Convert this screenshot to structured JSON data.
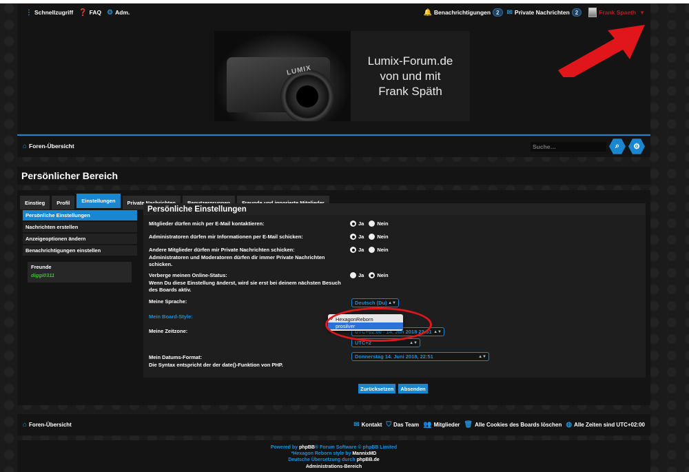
{
  "topnav": {
    "quicklinks": "Schnellzugriff",
    "faq": "FAQ",
    "admin": "Adm.",
    "notifications": "Benachrichtigungen",
    "notifications_count": "2",
    "messages": "Private Nachrichten",
    "messages_count": "2",
    "username": "Frank Spaeth"
  },
  "banner": {
    "line1": "Lumix-Forum.de",
    "line2": "von und mit",
    "line3": "Frank Späth",
    "camera_logo": "LUMIX"
  },
  "navbar": {
    "index_link": "Foren-Übersicht",
    "search_placeholder": "Suche…"
  },
  "page_title": "Persönlicher Bereich",
  "tabs": [
    {
      "label": "Einstieg"
    },
    {
      "label": "Profil"
    },
    {
      "label": "Einstellungen",
      "active": true
    },
    {
      "label": "Private Nachrichten"
    },
    {
      "label": "Benutzergruppen"
    },
    {
      "label": "Freunde und ignorierte Mitglieder"
    }
  ],
  "sidebar": {
    "items": [
      {
        "label": "Persönliche Einstellungen",
        "active": true
      },
      {
        "label": "Nachrichten erstellen"
      },
      {
        "label": "Anzeigeoptionen ändern"
      },
      {
        "label": "Benachrichtigungen einstellen"
      }
    ],
    "friends_heading": "Freunde",
    "friend_name": "diggi0311"
  },
  "settings": {
    "title": "Persönliche Einstellungen",
    "yes": "Ja",
    "no": "Nein",
    "email_contact": "Mitglieder dürfen mich per E-Mail kontaktieren:",
    "admin_email": "Administratoren dürfen mir Informationen per E-Mail schicken:",
    "pm_line1": "Andere Mitglieder dürfen mir Private Nachrichten schicken:",
    "pm_line2": "Administratoren und Moderatoren dürfen dir immer Private Nachrichten schicken.",
    "online_line1": "Verberge meinen Online-Status:",
    "online_line2": "Wenn Du diese Einstellung änderst, wird sie erst bei deinem nächsten Besuch des Boards aktiv.",
    "language_label": "Meine Sprache:",
    "language_value": "Deutsch (Du)",
    "style_label": "Mein Board-Style:",
    "style_options": [
      "HexagonReborn",
      "prosilver"
    ],
    "timezone_label": "Meine Zeitzone:",
    "timezone_value": "UTC+02:00 - 14. Jun 2018 22:51",
    "timezone_region": "UTC+2",
    "dateformat_line1": "Mein Datums-Format:",
    "dateformat_line2": "Die Syntax entspricht der der date()-Funktion von PHP.",
    "dateformat_value": "Donnerstag 14. Juni 2018, 22:51",
    "reset_button": "Zurücksetzen",
    "submit_button": "Absenden"
  },
  "footer": {
    "index_link": "Foren-Übersicht",
    "contact": "Kontakt",
    "team": "Das Team",
    "members": "Mitglieder",
    "delete_cookies": "Alle Cookies des Boards löschen",
    "timezone": "Alle Zeiten sind UTC+02:00",
    "powered_prefix": "Powered by",
    "powered_phpbb": "phpBB",
    "powered_suffix": "® Forum Software © phpBB Limited",
    "style_prefix": "*Hexagon Reborn style by",
    "style_author": "MannixMD",
    "translation_prefix": "Deutsche Übersetzung durch",
    "translation_site": "phpBB.de",
    "admin_link": "Administrations-Bereich"
  },
  "colors": {
    "accent": "#1a86d0",
    "username": "#b1201f",
    "annotation": "#e0161b",
    "friend": "#3bbf2d"
  }
}
